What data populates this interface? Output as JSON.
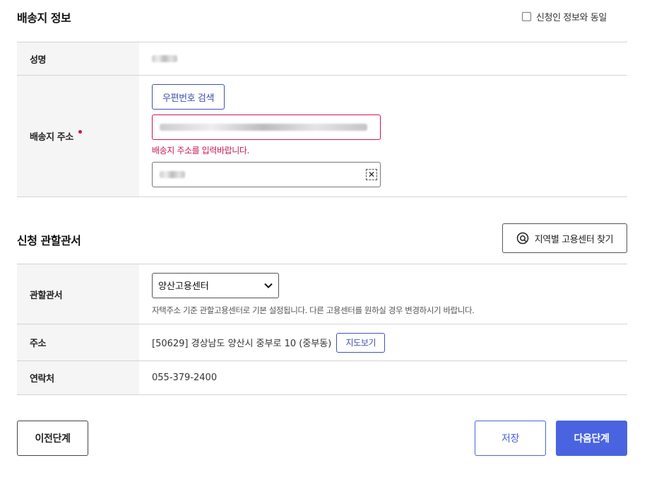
{
  "shipping": {
    "title": "배송지 정보",
    "same_as_applicant": "신청인 정보와 동일",
    "name_label": "성명",
    "address_label": "배송지 주소",
    "zip_search_button": "우편번호 검색",
    "address_error": "배송지 주소를 입력바랍니다.",
    "clear_icon": "close-icon"
  },
  "office": {
    "title": "신청 관할관서",
    "find_button": "지역별 고용센터 찾기",
    "jurisdiction_label": "관할관서",
    "selected_office": "양산고용센터",
    "hint": "자택주소 기준 관할고용센터로 기본 설정됩니다. 다른 고용센터를 원하실 경우 변경하시기 바랍니다.",
    "address_label": "주소",
    "address_value": "[50629] 경상남도 양산시 중부로 10 (중부동)",
    "map_button": "지도보기",
    "contact_label": "연락처",
    "contact_value": "055-379-2400"
  },
  "footer": {
    "prev_button": "이전단계",
    "save_button": "저장",
    "next_button": "다음단계"
  },
  "colors": {
    "accent": "#4a63e0",
    "error": "#c8174f",
    "link_blue": "#3f51b5"
  }
}
